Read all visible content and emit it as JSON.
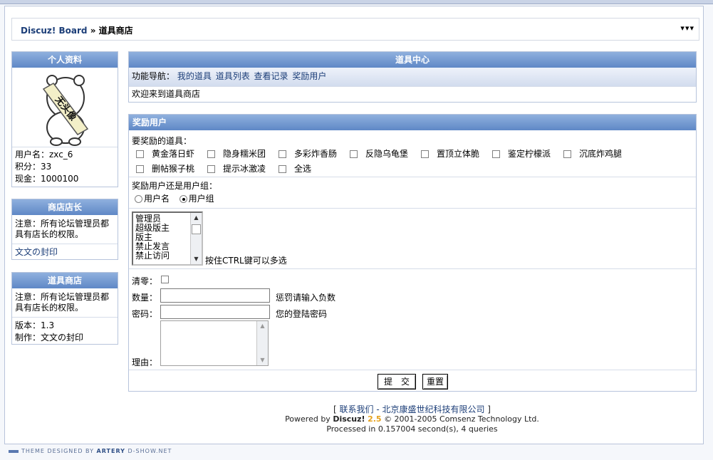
{
  "breadcrumb": {
    "home": "Discuz! Board",
    "sep": "»",
    "current": "道具商店",
    "arrows": "▾▾▾"
  },
  "profile": {
    "title": "个人资料",
    "avatar_text": "无头像",
    "username": "用户名：zxc_6",
    "points": "积分：33",
    "cash": "现金：1000100"
  },
  "manager": {
    "title": "商店店长",
    "note": "注意：所有论坛管理员都具有店长的权限。",
    "name": "文文の封印"
  },
  "shop": {
    "title": "道具商店",
    "note": "注意：所有论坛管理员都具有店长的权限。",
    "version": "版本：1.3",
    "author": "制作：文文の封印"
  },
  "center": {
    "title": "道具中心",
    "nav_label": "功能导航：",
    "nav_links": [
      "我的道具",
      "道具列表",
      "查看记录",
      "奖励用户"
    ],
    "welcome": "欢迎来到道具商店"
  },
  "reward": {
    "title": "奖励用户",
    "items_label": "要奖励的道具：",
    "items": [
      "黄金落日虾",
      "隐身糯米团",
      "多彩炸香肠",
      "反隐乌龟堡",
      "置顶立体脆",
      "鉴定柠檬派",
      "沉底炸鸡腿",
      "删帖猴子桃",
      "提示冰激凌",
      "全选"
    ],
    "target_label": "奖励用户还是用户组：",
    "target_options": [
      "用户名",
      "用户组"
    ],
    "target_selected": "用户组",
    "groups": [
      "管理员",
      "超级版主",
      "版主",
      "禁止发言",
      "禁止访问"
    ],
    "groups_hint": "按住CTRL键可以多选",
    "clear_label": "清零：",
    "amount_label": "数量：",
    "amount_hint": "惩罚请输入负数",
    "amount_value": "",
    "password_label": "密码：",
    "password_hint": "您的登陆密码",
    "password_value": "",
    "reason_label": "理由：",
    "reason_value": "",
    "submit_label": "提　交",
    "reset_label": "重置"
  },
  "footer": {
    "contact_open": "[ ",
    "contact": "联系我们",
    "company": " - 北京康盛世纪科技有限公司",
    "contact_close": " ]",
    "powered_prefix": "Powered by ",
    "brand": "Discuz!",
    "version": "2.5",
    "copyright": "© 2001-2005 Comsenz Technology Ltd.",
    "processed": "Processed in 0.157004 second(s), 4 queries"
  },
  "credit": {
    "text1": "THEME DESIGNED BY ",
    "brand": "ARTERY",
    "text2": " D-SHOW.NET"
  },
  "colors": {
    "header_top": "#8fb0de",
    "header_bottom": "#5f88c6",
    "link": "#1c3e78"
  }
}
